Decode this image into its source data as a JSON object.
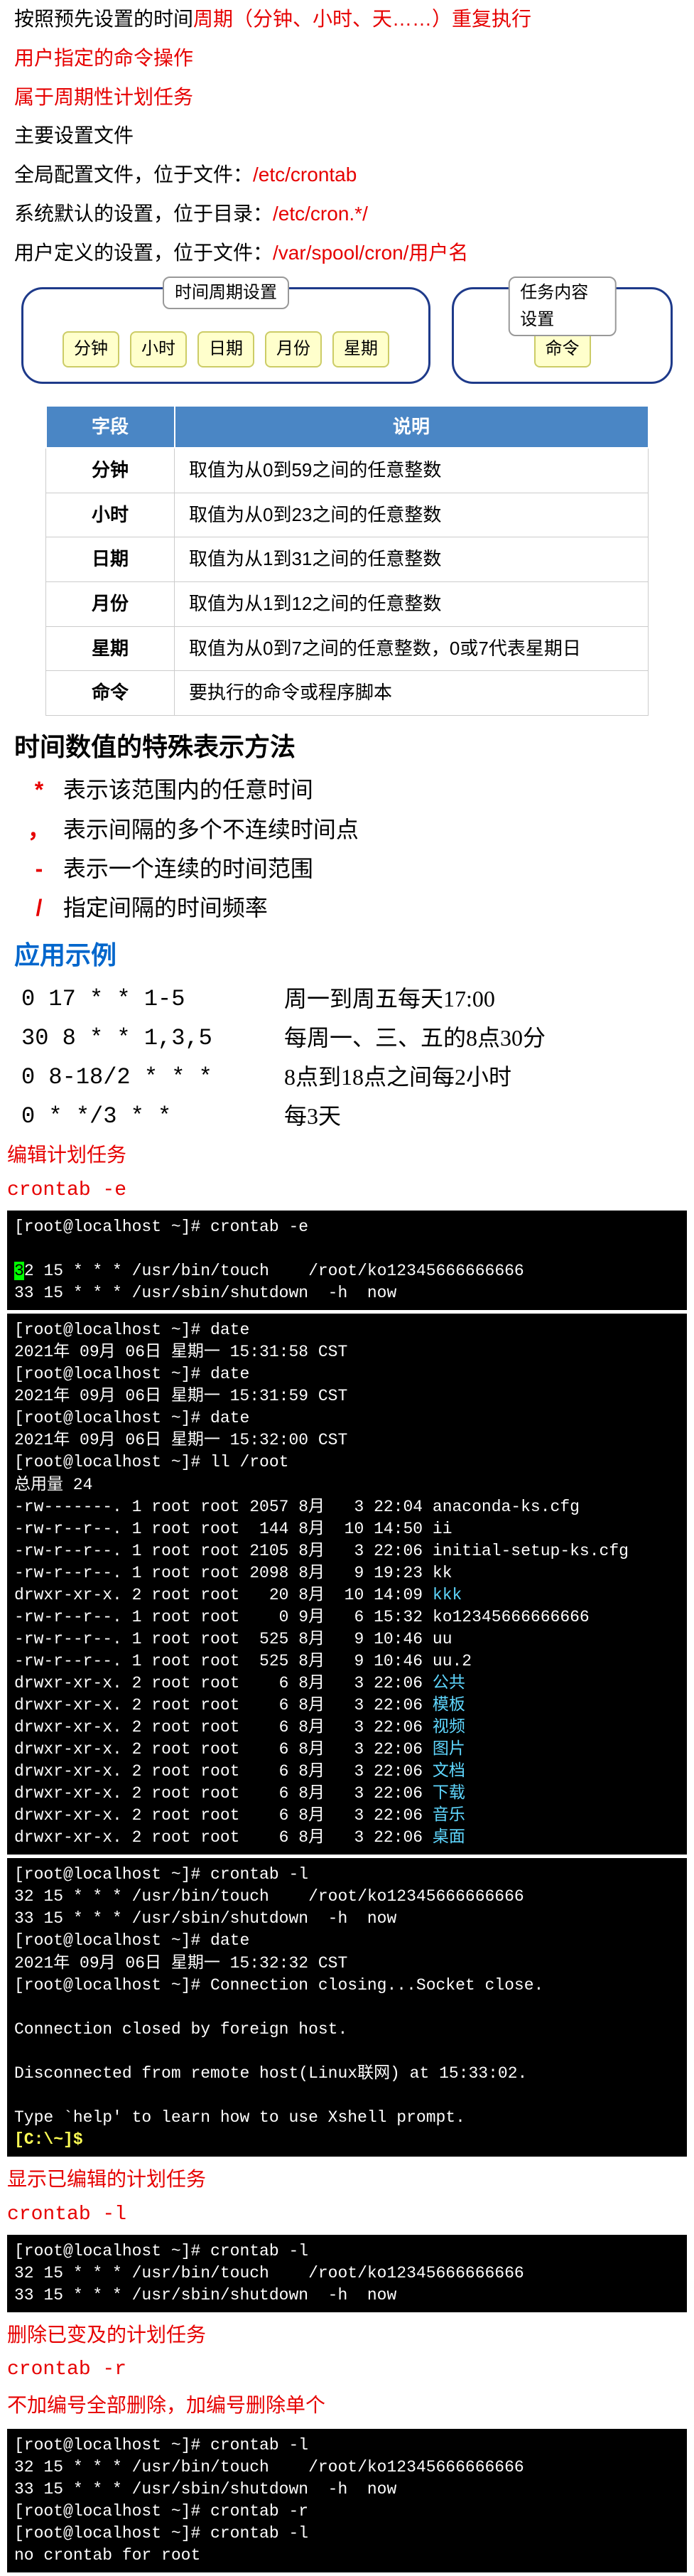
{
  "intro": {
    "line1a": "按照预先设置的时间",
    "line1b": "周期（分钟、小时、天……）重复执行",
    "line2": "用户指定的命令操作",
    "line3": "属于周期性计划任务",
    "line4": "主要设置文件",
    "line5a": "全局配置文件，位于文件：",
    "line5b": "/etc/crontab",
    "line6a": "系统默认的设置，位于目录：",
    "line6b": "/etc/cron.*/",
    "line7a": "用户定义的设置，位于文件：",
    "line7b": "/var/spool/cron/用户名"
  },
  "diagram": {
    "left_label": "时间周期设置",
    "right_label": "任务内容设置",
    "tags": [
      "分钟",
      "小时",
      "日期",
      "月份",
      "星期"
    ],
    "right_tag": "命令"
  },
  "table": {
    "h1": "字段",
    "h2": "说明",
    "rows": [
      {
        "f": "分钟",
        "d": "取值为从0到59之间的任意整数"
      },
      {
        "f": "小时",
        "d": "取值为从0到23之间的任意整数"
      },
      {
        "f": "日期",
        "d": "取值为从1到31之间的任意整数"
      },
      {
        "f": "月份",
        "d": "取值为从1到12之间的任意整数"
      },
      {
        "f": "星期",
        "d": "取值为从0到7之间的任意整数，0或7代表星期日"
      },
      {
        "f": "命令",
        "d": "要执行的命令或程序脚本"
      }
    ]
  },
  "special": {
    "title": "时间数值的特殊表示方法",
    "rows": [
      {
        "sym": "*",
        "desc": "表示该范围内的任意时间"
      },
      {
        "sym": "，",
        "desc": "表示间隔的多个不连续时间点"
      },
      {
        "sym": "-",
        "desc": "表示一个连续的时间范围"
      },
      {
        "sym": "/",
        "desc": "指定间隔的时间频率"
      }
    ]
  },
  "examples": {
    "title": "应用示例",
    "rows": [
      {
        "expr": "0 17 * * 1-5",
        "desc": "周一到周五每天17:00"
      },
      {
        "expr": "30 8 * * 1,3,5",
        "desc": "每周一、三、五的8点30分"
      },
      {
        "expr": "0 8-18/2 * * *",
        "desc": "8点到18点之间每2小时"
      },
      {
        "expr": "0 * */3 * *",
        "desc": "每3天"
      }
    ]
  },
  "edit": {
    "title": "编辑计划任务",
    "cmd": "crontab  -e"
  },
  "term1": {
    "prompt": "[root@localhost ~]# crontab -e",
    "l1a": "3",
    "l1b": "2 15 * * * /usr/bin/touch    /root/ko12345666666666",
    "l2": "33 15 * * * /usr/sbin/shutdown  -h  now"
  },
  "term2_lines": {
    "p1": "[root@localhost ~]# date",
    "d1": "2021年 09月 06日 星期一 15:31:58 CST",
    "p2": "[root@localhost ~]# date",
    "d2": "2021年 09月 06日 星期一 15:31:59 CST",
    "p3": "[root@localhost ~]# date",
    "d3": "2021年 09月 06日 星期一 15:32:00 CST",
    "p4": "[root@localhost ~]# ll /root",
    "total": "总用量 24",
    "r01": "-rw-------. 1 root root 2057 8月   3 22:04 anaconda-ks.cfg",
    "r02": "-rw-r--r--. 1 root root  144 8月  10 14:50 ii",
    "r03": "-rw-r--r--. 1 root root 2105 8月   3 22:06 initial-setup-ks.cfg",
    "r04": "-rw-r--r--. 1 root root 2098 8月   9 19:23 kk",
    "r05a": "drwxr-xr-x. 2 root root   20 8月  10 14:09 ",
    "r05b": "kkk",
    "r06": "-rw-r--r--. 1 root root    0 9月   6 15:32 ko12345666666666",
    "r07": "-rw-r--r--. 1 root root  525 8月   9 10:46 uu",
    "r08": "-rw-r--r--. 1 root root  525 8月   9 10:46 uu.2",
    "r09a": "drwxr-xr-x. 2 root root    6 8月   3 22:06 ",
    "r09b": "公共",
    "r10a": "drwxr-xr-x. 2 root root    6 8月   3 22:06 ",
    "r10b": "模板",
    "r11a": "drwxr-xr-x. 2 root root    6 8月   3 22:06 ",
    "r11b": "视频",
    "r12a": "drwxr-xr-x. 2 root root    6 8月   3 22:06 ",
    "r12b": "图片",
    "r13a": "drwxr-xr-x. 2 root root    6 8月   3 22:06 ",
    "r13b": "文档",
    "r14a": "drwxr-xr-x. 2 root root    6 8月   3 22:06 ",
    "r14b": "下载",
    "r15a": "drwxr-xr-x. 2 root root    6 8月   3 22:06 ",
    "r15b": "音乐",
    "r16a": "drwxr-xr-x. 2 root root    6 8月   3 22:06 ",
    "r16b": "桌面"
  },
  "term3": {
    "l1": "[root@localhost ~]# crontab -l",
    "l2": "32 15 * * * /usr/bin/touch    /root/ko12345666666666",
    "l3": "33 15 * * * /usr/sbin/shutdown  -h  now",
    "l4": "[root@localhost ~]# date",
    "l5": "2021年 09月 06日 星期一 15:32:32 CST",
    "l6": "[root@localhost ~]# Connection closing...Socket close.",
    "l7": "",
    "l8": "Connection closed by foreign host.",
    "l9": "",
    "l10": "Disconnected from remote host(Linux联网) at 15:33:02.",
    "l11": "",
    "l12": "Type `help' to learn how to use Xshell prompt.",
    "l13a": "[C:\\~]$",
    "l13b": ""
  },
  "show": {
    "title": "显示已编辑的计划任务",
    "cmd": "crontab  -l"
  },
  "term4": {
    "l1": "[root@localhost ~]# crontab -l",
    "l2": "32 15 * * * /usr/bin/touch    /root/ko12345666666666",
    "l3": "33 15 * * * /usr/sbin/shutdown  -h  now"
  },
  "del": {
    "title": "删除已变及的计划任务",
    "cmd": "crontab  -r",
    "note": "不加编号全部删除，加编号删除单个"
  },
  "term5": {
    "l1": "[root@localhost ~]# crontab -l",
    "l2": "32 15 * * * /usr/bin/touch    /root/ko12345666666666",
    "l3": "33 15 * * * /usr/sbin/shutdown  -h  now",
    "l4": "[root@localhost ~]# crontab -r",
    "l5": "[root@localhost ~]# crontab -l",
    "l6": "no crontab for root"
  }
}
